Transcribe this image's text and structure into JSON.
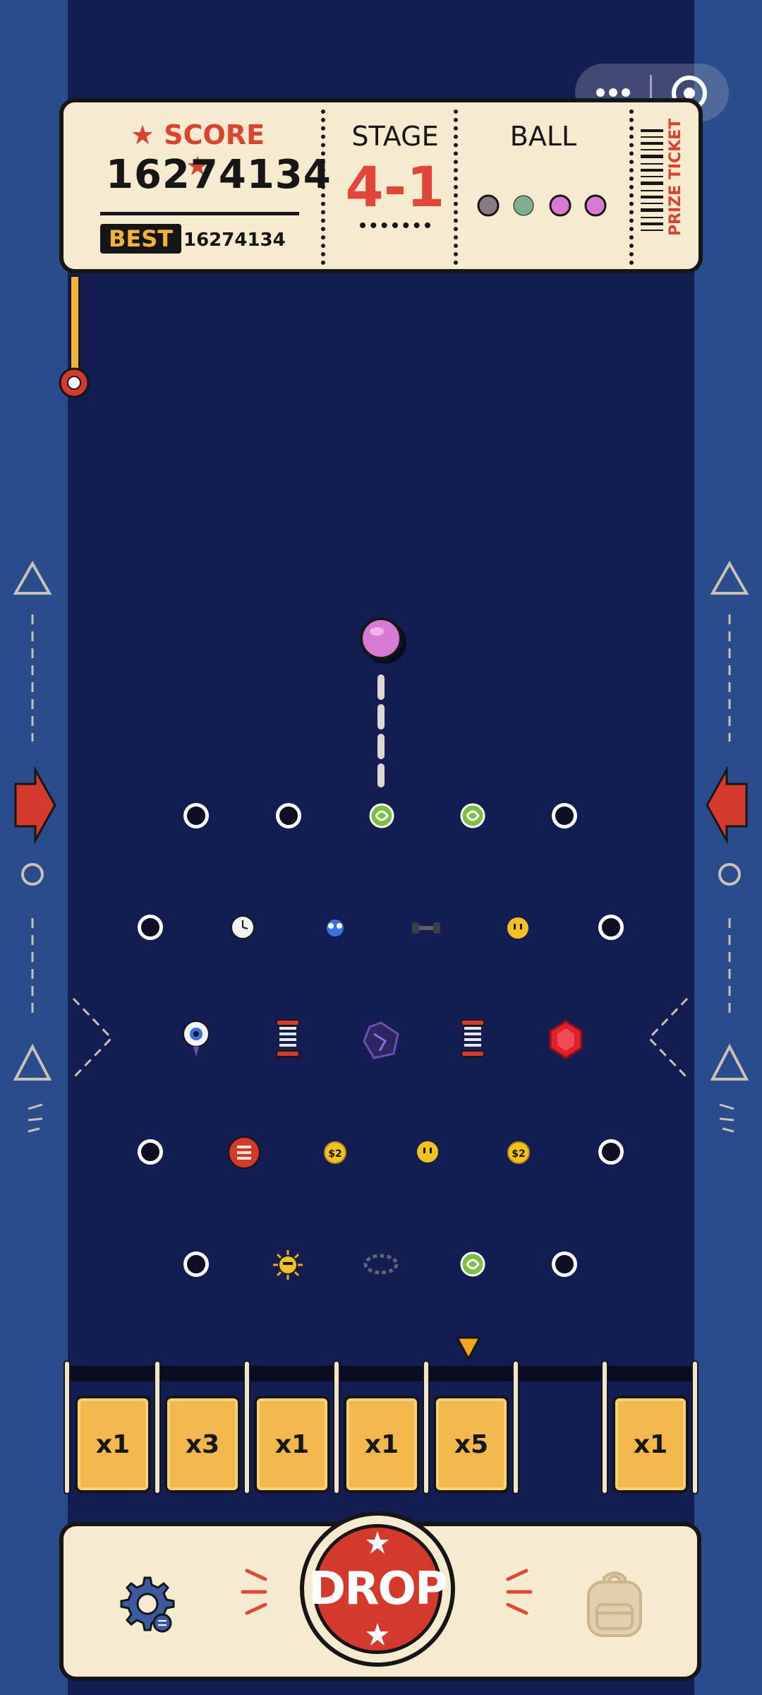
{
  "header": {
    "score_label": "SCORE",
    "score_value": "16274134",
    "best_label": "BEST",
    "best_value": "16274134",
    "stage_label": "STAGE",
    "stage_value": "4-1",
    "ball_label": "BALL",
    "prize_ticket": "PRIZE TICKET"
  },
  "balls_remaining": [
    "grey-ball",
    "green-ball",
    "pink-ball",
    "pink-ball"
  ],
  "power_meter": {
    "level": 1.0
  },
  "buckets": [
    {
      "label": "x1"
    },
    {
      "label": "x3"
    },
    {
      "label": "x1"
    },
    {
      "label": "x1"
    },
    {
      "label": "x5"
    },
    {
      "label": "x1"
    }
  ],
  "bottom_bar": {
    "drop_label": "DROP"
  },
  "colors": {
    "board": "#141d52",
    "side": "#2a4c8c",
    "ticket": "#f6ebd1",
    "accent_red": "#d33a2c",
    "bucket_gold": "#f2b84c"
  },
  "items": [
    "green-swirl-icon",
    "clock-icon",
    "blue-creature-icon",
    "dumbbell-icon",
    "smiley-icon",
    "eyeball-icon",
    "spring-icon",
    "purple-crystal-icon",
    "red-gem-icon",
    "coiled-spring-icon",
    "coin-icon",
    "sun-icon",
    "rock-ring-icon"
  ]
}
